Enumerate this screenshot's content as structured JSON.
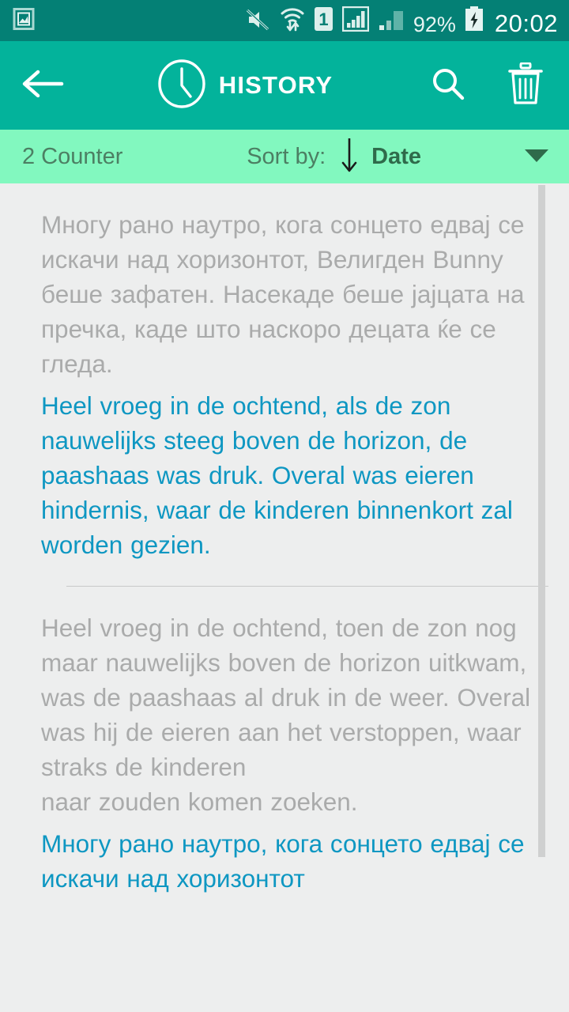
{
  "status_bar": {
    "background": "#048075",
    "icons": [
      "image-notification-icon",
      "sound-muted-icon",
      "wifi-transfer-icon",
      "sim-one-icon",
      "signal-bars-full-icon",
      "signal-bars-weak-icon"
    ],
    "sim_label": "1",
    "battery_percent": "92%",
    "battery_state": "charging",
    "clock": "20:02"
  },
  "app_bar": {
    "background": "#03B39B",
    "back_icon": "arrow-left-icon",
    "clock_icon": "clock-icon",
    "title": "HISTORY",
    "search_icon": "search-icon",
    "delete_icon": "trash-icon"
  },
  "sort_bar": {
    "background": "#82F8BF",
    "counter": "2 Counter",
    "sort_by_label": "Sort by:",
    "sort_direction_icon": "arrow-down-icon",
    "sort_value": "Date",
    "dropdown_icon": "caret-down-icon"
  },
  "colors": {
    "source_text": "#AAABAB",
    "target_text": "#0E97C2",
    "divider": "#C9CACA",
    "content_background": "#EDEEEE",
    "scrollbar": "#CFD0D0"
  },
  "history": {
    "entries": [
      {
        "source_text": "Многу рано наутро, кога сонцето едвај се искачи над хоризонтот, Велигден Bunny беше зафатен. Насекаде беше јајцата на пречка, каде што наскоро децата ќе се гледа.",
        "target_text": "Heel vroeg in de ochtend, als de zon nauwelijks steeg boven de horizon, de paashaas was druk. Overal was eieren hindernis, waar de kinderen binnenkort zal worden gezien."
      },
      {
        "source_text": "Heel vroeg in de ochtend, toen de zon nog maar nauwelijks boven de horizon uitkwam, was de paashaas al druk in de weer. Overal was hij de eieren aan het verstoppen, waar straks de kinderen\nnaar zouden komen zoeken.",
        "target_text": "Многу рано наутро, кога сонцето едвај се искачи над хоризонтот"
      }
    ]
  }
}
